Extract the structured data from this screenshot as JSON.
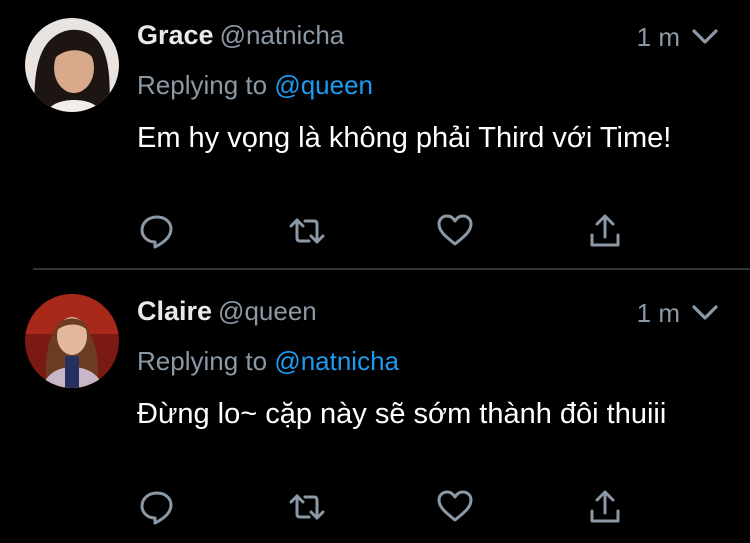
{
  "tweets": [
    {
      "name": "Grace",
      "handle": "@natnicha",
      "time": "1 m",
      "replying_prefix": "Replying to",
      "replying_to": "@queen",
      "text": "Em hy vọng là không phải Third với Time!",
      "icons": [
        "reply-icon",
        "retweet-icon",
        "like-icon",
        "share-icon"
      ]
    },
    {
      "name": "Claire",
      "handle": "@queen",
      "time": "1 m",
      "replying_prefix": "Replying to",
      "replying_to": "@natnicha",
      "text": "Đừng lo~ cặp này sẽ sớm thành đôi thuiii",
      "icons": [
        "reply-icon",
        "retweet-icon",
        "like-icon",
        "share-icon"
      ]
    }
  ],
  "colors": {
    "background": "#000000",
    "secondary_text": "#8b98a5",
    "mention": "#1d9bf0",
    "divider": "#2f3336"
  }
}
